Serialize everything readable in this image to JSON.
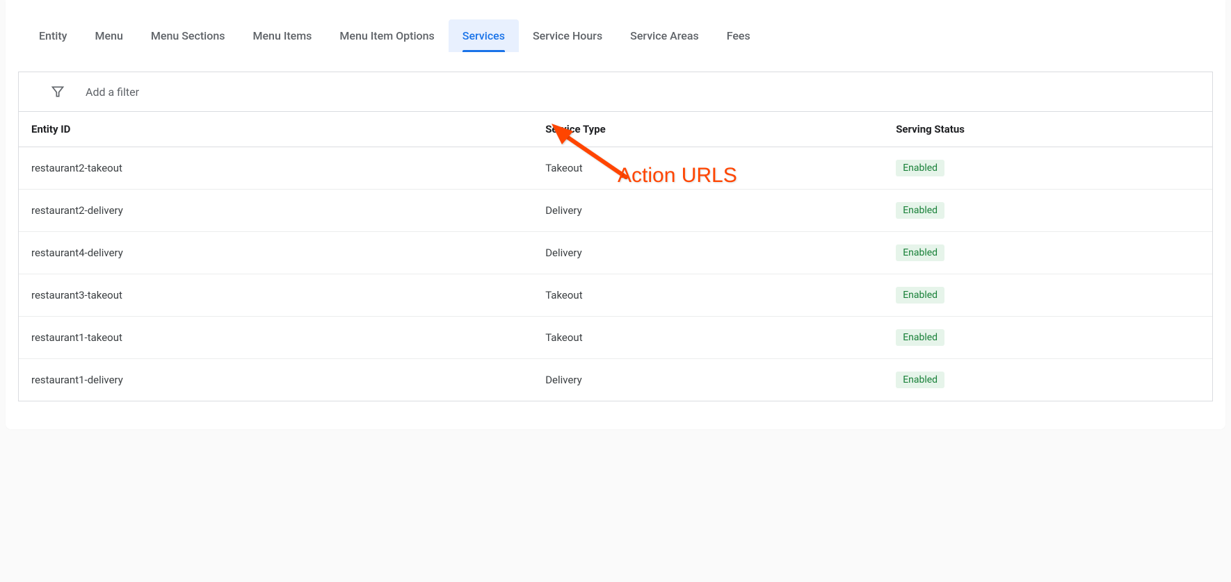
{
  "tabs": [
    {
      "label": "Entity",
      "active": false
    },
    {
      "label": "Menu",
      "active": false
    },
    {
      "label": "Menu Sections",
      "active": false
    },
    {
      "label": "Menu Items",
      "active": false
    },
    {
      "label": "Menu Item Options",
      "active": false
    },
    {
      "label": "Services",
      "active": true
    },
    {
      "label": "Service Hours",
      "active": false
    },
    {
      "label": "Service Areas",
      "active": false
    },
    {
      "label": "Fees",
      "active": false
    }
  ],
  "annotation": {
    "label": "Action URLS"
  },
  "filter": {
    "placeholder": "Add a filter"
  },
  "columns": {
    "col0": "Entity ID",
    "col1": "Service Type",
    "col2": "Serving Status"
  },
  "rows": [
    {
      "entity_id": "restaurant2-takeout",
      "service_type": "Takeout",
      "status": "Enabled"
    },
    {
      "entity_id": "restaurant2-delivery",
      "service_type": "Delivery",
      "status": "Enabled"
    },
    {
      "entity_id": "restaurant4-delivery",
      "service_type": "Delivery",
      "status": "Enabled"
    },
    {
      "entity_id": "restaurant3-takeout",
      "service_type": "Takeout",
      "status": "Enabled"
    },
    {
      "entity_id": "restaurant1-takeout",
      "service_type": "Takeout",
      "status": "Enabled"
    },
    {
      "entity_id": "restaurant1-delivery",
      "service_type": "Delivery",
      "status": "Enabled"
    }
  ]
}
